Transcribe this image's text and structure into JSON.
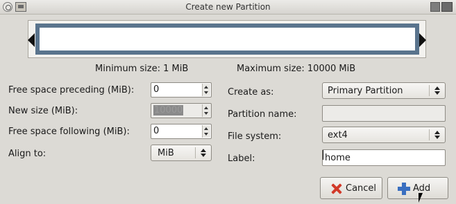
{
  "window": {
    "title": "Create new Partition"
  },
  "partition_visual": {
    "bar_color": "#5a748d"
  },
  "size_limits": {
    "minimum": "Minimum size: 1 MiB",
    "maximum": "Maximum size: 10000 MiB"
  },
  "left": {
    "free_preceding": {
      "label": "Free space preceding (MiB):",
      "value": "0"
    },
    "new_size": {
      "label": "New size (MiB):",
      "value": "10000"
    },
    "free_following": {
      "label": "Free space following (MiB):",
      "value": "0"
    },
    "align": {
      "label": "Align to:",
      "value": "MiB"
    }
  },
  "right": {
    "create_as": {
      "label": "Create as:",
      "value": "Primary Partition"
    },
    "partition_name": {
      "label": "Partition name:",
      "value": ""
    },
    "file_system": {
      "label": "File system:",
      "value": "ext4"
    },
    "fs_label": {
      "label": "Label:",
      "value": "home"
    }
  },
  "buttons": {
    "cancel": "Cancel",
    "add": "Add"
  },
  "icons": {
    "cancel": "cancel-x-icon",
    "add": "add-plus-icon"
  }
}
